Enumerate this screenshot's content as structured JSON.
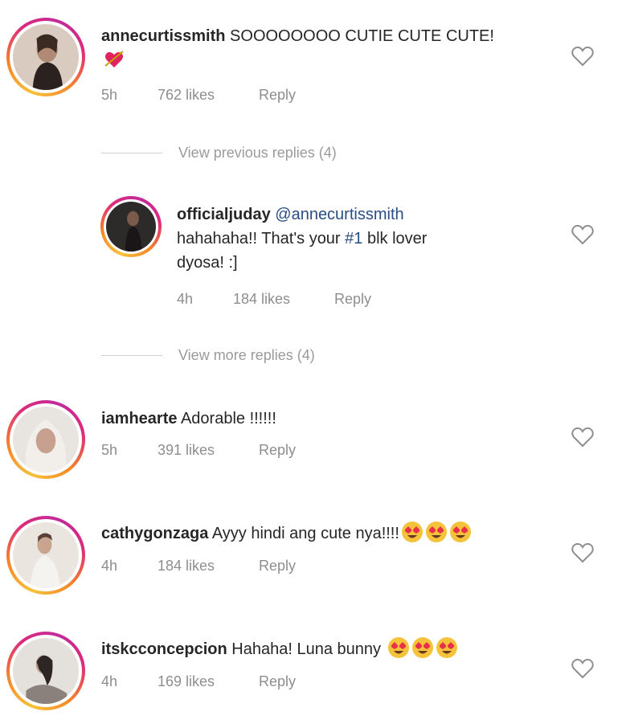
{
  "heart_color": "#8e8e8e",
  "mention_color": "#2a4d84",
  "comments": [
    {
      "username": "annecurtissmith",
      "text": "SOOOOOOOO CUTIE CUTE CUTE!",
      "emoji": "heart-arrow",
      "time": "5h",
      "likes": "762 likes",
      "reply": "Reply"
    },
    {
      "username": "officialjuday",
      "mention": "@annecurtissmith",
      "text_line2_a": "hahahaha!! That's your ",
      "hashtag": "#1",
      "text_line2_b": " blk lover",
      "text_line3": "dyosa! :]",
      "time": "4h",
      "likes": "184 likes",
      "reply": "Reply"
    },
    {
      "username": "iamhearte",
      "text": "Adorable !!!!!!",
      "time": "5h",
      "likes": "391 likes",
      "reply": "Reply"
    },
    {
      "username": "cathygonzaga",
      "text": "Ayyy hindi ang cute nya!!!!",
      "emoji": "heart-eyes x3",
      "time": "4h",
      "likes": "184 likes",
      "reply": "Reply"
    },
    {
      "username": "itskcconcepcion",
      "text": "Hahaha! Luna bunny",
      "emoji": "heart-eyes x3",
      "time": "4h",
      "likes": "169 likes",
      "reply": "Reply"
    }
  ],
  "view_previous": "View previous replies (4)",
  "view_more": "View more replies (4)"
}
